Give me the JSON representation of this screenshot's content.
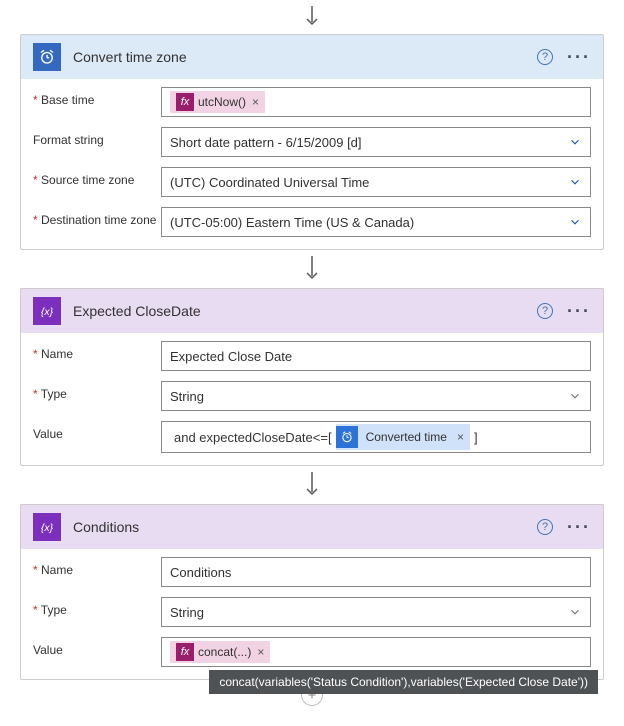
{
  "cards": [
    {
      "title": "Convert time zone",
      "rows": {
        "base_time_label": "Base time",
        "base_time_token": "utcNow()",
        "format_label": "Format string",
        "format_value": "Short date pattern - 6/15/2009 [d]",
        "source_tz_label": "Source time zone",
        "source_tz_value": "(UTC) Coordinated Universal Time",
        "dest_tz_label": "Destination time zone",
        "dest_tz_value": "(UTC-05:00) Eastern Time (US & Canada)"
      }
    },
    {
      "title": "Expected CloseDate",
      "rows": {
        "name_label": "Name",
        "name_value": "Expected Close Date",
        "type_label": "Type",
        "type_value": "String",
        "value_label": "Value",
        "value_prefix": " and expectedCloseDate<=[",
        "value_token": "Converted time",
        "value_suffix": "]"
      }
    },
    {
      "title": "Conditions",
      "rows": {
        "name_label": "Name",
        "name_value": "Conditions",
        "type_label": "Type",
        "type_value": "String",
        "value_label": "Value",
        "value_token": "concat(...)",
        "tooltip": "concat(variables('Status Condition'),variables('Expected Close Date'))"
      }
    }
  ],
  "icons": {
    "fx": "fx",
    "help": "?",
    "close": "×",
    "plus": "+"
  }
}
